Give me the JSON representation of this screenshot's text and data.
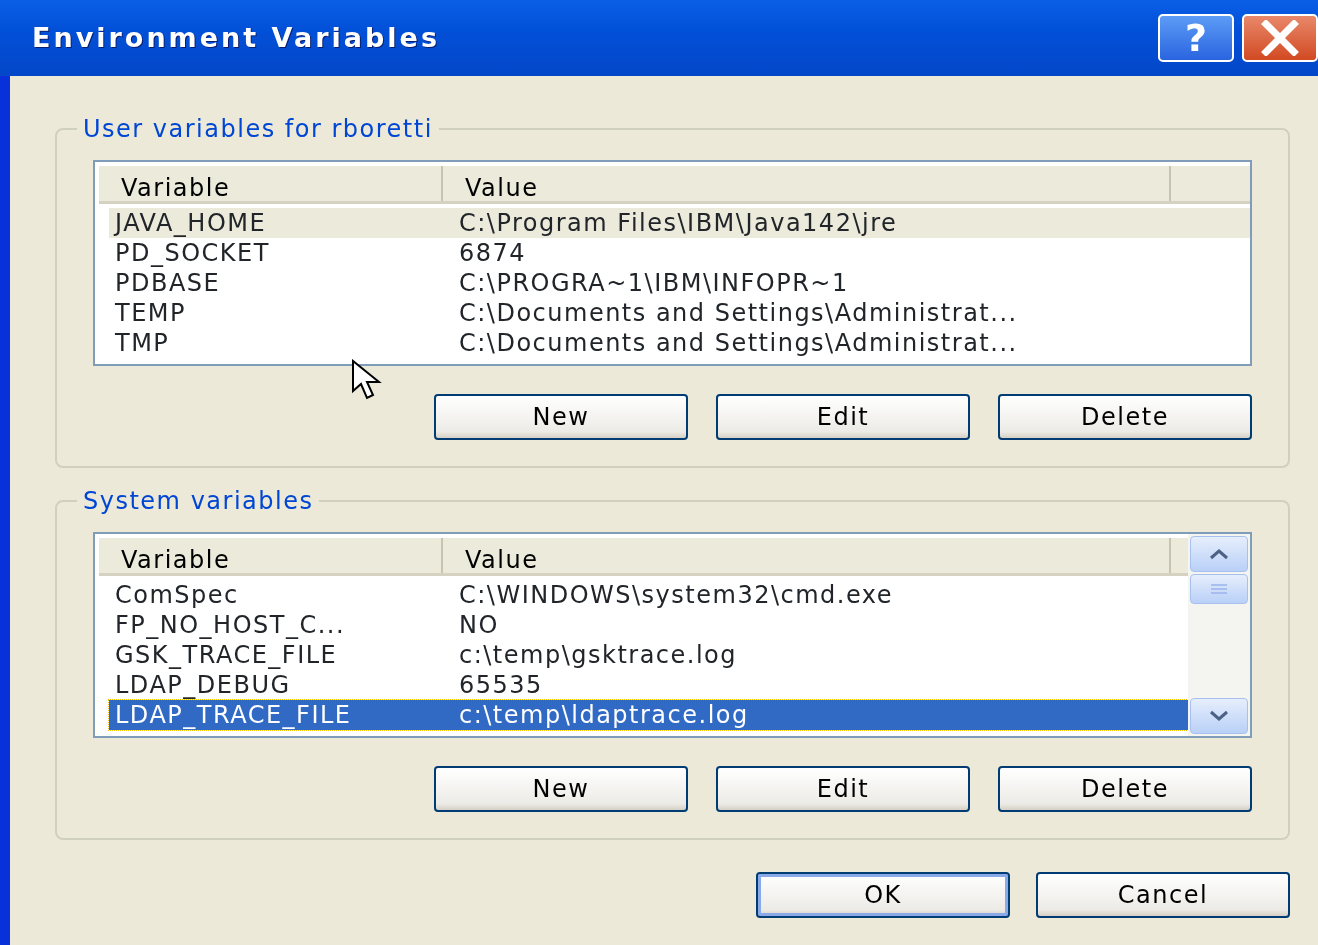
{
  "window": {
    "title": "Environment Variables",
    "help_label": "?"
  },
  "groups": [
    {
      "legend": "User variables for rboretti",
      "focused": false,
      "scrollbar": false,
      "columns": [
        "Variable",
        "Value"
      ],
      "rows": [
        {
          "variable": "JAVA_HOME",
          "value": "C:\\Program Files\\IBM\\Java142\\jre",
          "selected": true
        },
        {
          "variable": "PD_SOCKET",
          "value": "6874",
          "selected": false
        },
        {
          "variable": "PDBASE",
          "value": "C:\\PROGRA~1\\IBM\\INFOPR~1",
          "selected": false
        },
        {
          "variable": "TEMP",
          "value": "C:\\Documents and Settings\\Administrat...",
          "selected": false
        },
        {
          "variable": "TMP",
          "value": "C:\\Documents and Settings\\Administrat...",
          "selected": false
        }
      ],
      "buttons": [
        "New",
        "Edit",
        "Delete"
      ]
    },
    {
      "legend": "System variables",
      "focused": true,
      "scrollbar": true,
      "columns": [
        "Variable",
        "Value"
      ],
      "rows": [
        {
          "variable": "ComSpec",
          "value": "C:\\WINDOWS\\system32\\cmd.exe",
          "selected": false
        },
        {
          "variable": "FP_NO_HOST_C...",
          "value": "NO",
          "selected": false
        },
        {
          "variable": "GSK_TRACE_FILE",
          "value": "c:\\temp\\gsktrace.log",
          "selected": false
        },
        {
          "variable": "LDAP_DEBUG",
          "value": "65535",
          "selected": false
        },
        {
          "variable": "LDAP_TRACE_FILE",
          "value": "c:\\temp\\ldaptrace.log",
          "selected": true
        }
      ],
      "buttons": [
        "New",
        "Edit",
        "Delete"
      ]
    }
  ],
  "footer_buttons": [
    {
      "label": "OK",
      "default": true
    },
    {
      "label": "Cancel",
      "default": false
    }
  ]
}
